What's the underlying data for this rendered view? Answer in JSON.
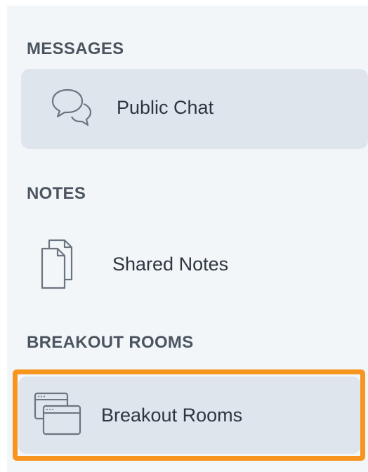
{
  "sections": {
    "messages": {
      "title": "MESSAGES",
      "items": [
        {
          "label": "Public Chat",
          "icon": "chat-icon",
          "active": true
        }
      ]
    },
    "notes": {
      "title": "NOTES",
      "items": [
        {
          "label": "Shared Notes",
          "icon": "shared-notes-icon",
          "active": false
        }
      ]
    },
    "breakout": {
      "title": "BREAKOUT ROOMS",
      "items": [
        {
          "label": "Breakout Rooms",
          "icon": "breakout-rooms-icon",
          "active": true
        }
      ]
    }
  },
  "colors": {
    "panel_bg": "#f3f6f9",
    "active_item_bg": "#dfe5ed",
    "highlight_border": "#f7951e",
    "text": "#2d3640"
  }
}
